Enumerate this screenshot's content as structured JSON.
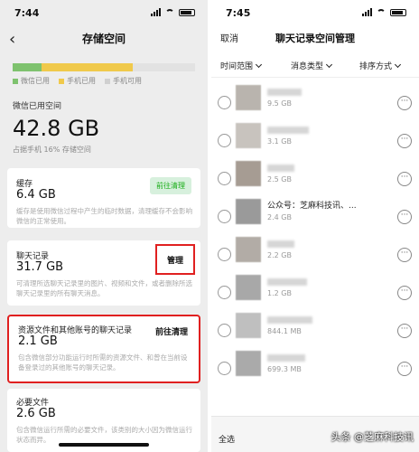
{
  "left": {
    "status_time": "7:44",
    "title": "存储空间",
    "legend": [
      "微信已用",
      "手机已用",
      "手机可用"
    ],
    "usage_fraction": {
      "wechat": 0.16,
      "phone": 0.5
    },
    "wechat_label": "微信已用空间",
    "wechat_total": "42.8 GB",
    "wechat_sub": "占据手机 16% 存储空间",
    "cache": {
      "label": "缓存",
      "value": "6.4 GB",
      "desc": "缓存是使用微信过程中产生的临时数据，清理缓存不会影响微信的正常使用。",
      "button": "前往清理"
    },
    "chat": {
      "label": "聊天记录",
      "value": "31.7 GB",
      "desc": "可清理所选聊天记录里的图片、视频和文件，或者删除所选聊天记录里的所有聊天消息。",
      "button": "管理"
    },
    "resource": {
      "label": "资源文件和其他账号的聊天记录",
      "value": "2.1 GB",
      "desc": "包含微信部分功能运行时所需的资源文件、和曾在当前设备登录过的其他账号的聊天记录。",
      "button": "前往清理"
    },
    "required": {
      "label": "必要文件",
      "value": "2.6 GB",
      "desc": "包含微信运行所需的必要文件，该类别的大小因为微信运行状态而异。"
    }
  },
  "right": {
    "status_time": "7:45",
    "cancel": "取消",
    "title": "聊天记录空间管理",
    "filters": [
      "时间范围",
      "消息类型",
      "排序方式"
    ],
    "rows": [
      {
        "name": "",
        "size": "9.5 GB"
      },
      {
        "name": "",
        "size": "3.1 GB"
      },
      {
        "name": "",
        "size": "2.5 GB"
      },
      {
        "name": "公众号：芝麻科技讯、...",
        "size": "2.4 GB"
      },
      {
        "name": "",
        "size": "2.2 GB"
      },
      {
        "name": "",
        "size": "1.2 GB"
      },
      {
        "name": "",
        "size": "844.1 MB"
      },
      {
        "name": "",
        "size": "699.3 MB"
      }
    ],
    "select_all": "全选",
    "watermark": "头条 @芝麻科技讯",
    "more_glyph": "···"
  }
}
